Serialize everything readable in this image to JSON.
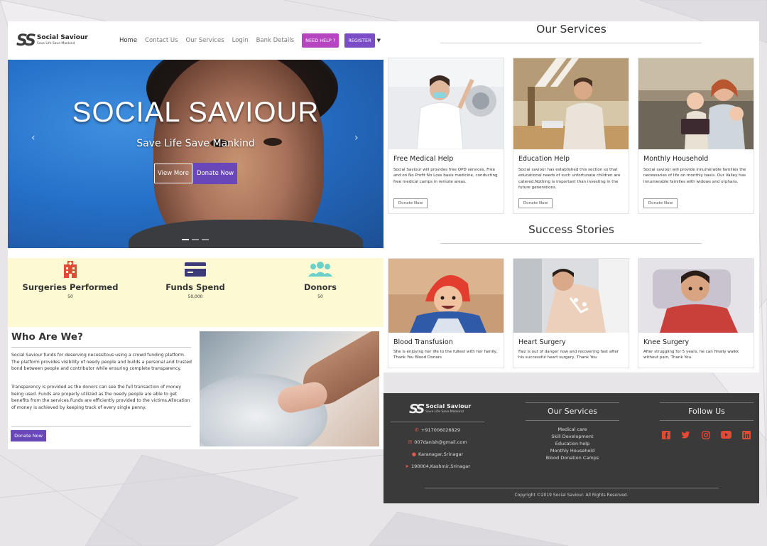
{
  "colors": {
    "accent_purple": "#6a47b8",
    "need_help_bg": "#b546c0",
    "register_bg": "#7a4dc7",
    "stats_bg": "#fcf9d3",
    "footer_bg": "#3a3a3a",
    "icon_red": "#e04b36",
    "icon_navy": "#3d3a7a",
    "icon_teal": "#6ad1c9"
  },
  "brand": {
    "mark": "SS",
    "name": "Social Saviour",
    "tagline": "Save Life Save Mankind"
  },
  "nav": {
    "links": [
      "Home",
      "Contact Us",
      "Our Services",
      "Login",
      "Bank Details"
    ],
    "need_help": "NEED HELP ?",
    "register": "REGISTER"
  },
  "hero": {
    "title": "SOCIAL SAVIOUR",
    "subtitle": "Save Life Save Mankind",
    "view_more": "View More",
    "donate_now": "Donate Now",
    "prev_icon": "chevron-left-icon",
    "next_icon": "chevron-right-icon"
  },
  "stats": [
    {
      "icon": "hospital-icon",
      "label": "Surgeries Performed",
      "value": "50"
    },
    {
      "icon": "credit-card-icon",
      "label": "Funds Spend",
      "value": "50,000"
    },
    {
      "icon": "users-icon",
      "label": "Donors",
      "value": "50"
    }
  ],
  "who": {
    "title": "Who Are We?",
    "p1": "Social Saviour funds for deserving necessitous using a crowd funding platform. The platform provides visibility of needy people and builds a personal and trusted bond between people and contributor while ensuring complete transparency.",
    "p2": "Transparency is provided as the donors can see the full transaction of money being used. Funds are properly utilized as the needy people are able to get benefits from the services.Funds are efficiently provided to the victims.Allocation of money is achieved by keeping track of every single penny.",
    "donate": "Donate Now"
  },
  "services": {
    "title": "Our Services",
    "items": [
      {
        "title": "Free Medical Help",
        "body": "Social Saviour will provides free OPD services, Free and on No Profit No Loss basis medicine, conducting free medical camps in remote areas.",
        "button": "Donate Now"
      },
      {
        "title": "Education Help",
        "body": "Social saviour has established this section so that educational needs of such unfortunate children are catered.Nothing is important than investing in the future generations.",
        "button": "Donate Now"
      },
      {
        "title": "Monthly Household",
        "body": "Social saviour will provide innumerable families the necessaries of life on monthly basis. Our Valley has innumerable families with widows and orphans.",
        "button": "Donate Now"
      }
    ]
  },
  "stories": {
    "title": "Success Stories",
    "items": [
      {
        "title": "Blood Transfusion",
        "body": "She is enjoying her life to the fullest with her family, Thank You Blood Donars"
      },
      {
        "title": "Heart Surgery",
        "body": "Faiz is out of danger now and recovering fast after his successful heart surgery, Thank You"
      },
      {
        "title": "Knee Surgery",
        "body": "After struggling for 5 years, he can finally walkk without pain, Thank You."
      }
    ]
  },
  "footer": {
    "contact": [
      {
        "icon": "phone-icon",
        "text": "+917006026829"
      },
      {
        "icon": "envelope-icon",
        "text": "007danish@gmail.com"
      },
      {
        "icon": "map-pin-icon",
        "text": "Karanagar,Srinagar"
      },
      {
        "icon": "location-arrow-icon",
        "text": "190004,Kashmir,Srinagar"
      }
    ],
    "services_title": "Our Services",
    "services": [
      "Medical care",
      "Skill Development",
      "Education help",
      "Monthly Household",
      "Blood Donation Camps"
    ],
    "follow_title": "Follow Us",
    "social": [
      "facebook-icon",
      "twitter-icon",
      "instagram-icon",
      "youtube-icon",
      "linkedin-icon"
    ],
    "copyright": "Copyright ©2019 Social Saviour. All Rights Reserved."
  }
}
